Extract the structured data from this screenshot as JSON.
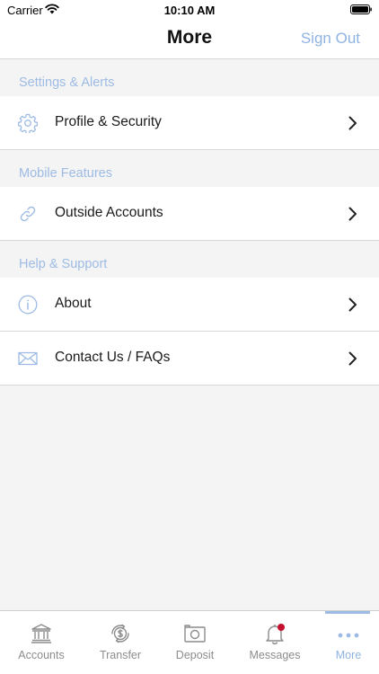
{
  "status_bar": {
    "carrier": "Carrier",
    "time": "10:10 AM"
  },
  "nav": {
    "title": "More",
    "sign_out_label": "Sign Out"
  },
  "sections": [
    {
      "header": "Settings & Alerts",
      "items": [
        {
          "label": "Profile & Security",
          "icon": "gear-icon"
        }
      ]
    },
    {
      "header": "Mobile Features",
      "items": [
        {
          "label": "Outside Accounts",
          "icon": "link-icon"
        }
      ]
    },
    {
      "header": "Help & Support",
      "items": [
        {
          "label": "About",
          "icon": "info-icon"
        },
        {
          "label": "Contact Us / FAQs",
          "icon": "envelope-icon"
        }
      ]
    }
  ],
  "tabs": [
    {
      "label": "Accounts",
      "icon": "bank-icon",
      "active": false
    },
    {
      "label": "Transfer",
      "icon": "transfer-dollar-icon",
      "active": false
    },
    {
      "label": "Deposit",
      "icon": "camera-icon",
      "active": false
    },
    {
      "label": "Messages",
      "icon": "bell-icon",
      "active": false,
      "badge": true
    },
    {
      "label": "More",
      "icon": "more-dots-icon",
      "active": true
    }
  ],
  "colors": {
    "accent": "#8fb3e0",
    "section_header_text": "#9dbbe4",
    "background": "#f4f4f4",
    "badge": "#c4102e",
    "inactive_tab": "#8c8c8c"
  }
}
